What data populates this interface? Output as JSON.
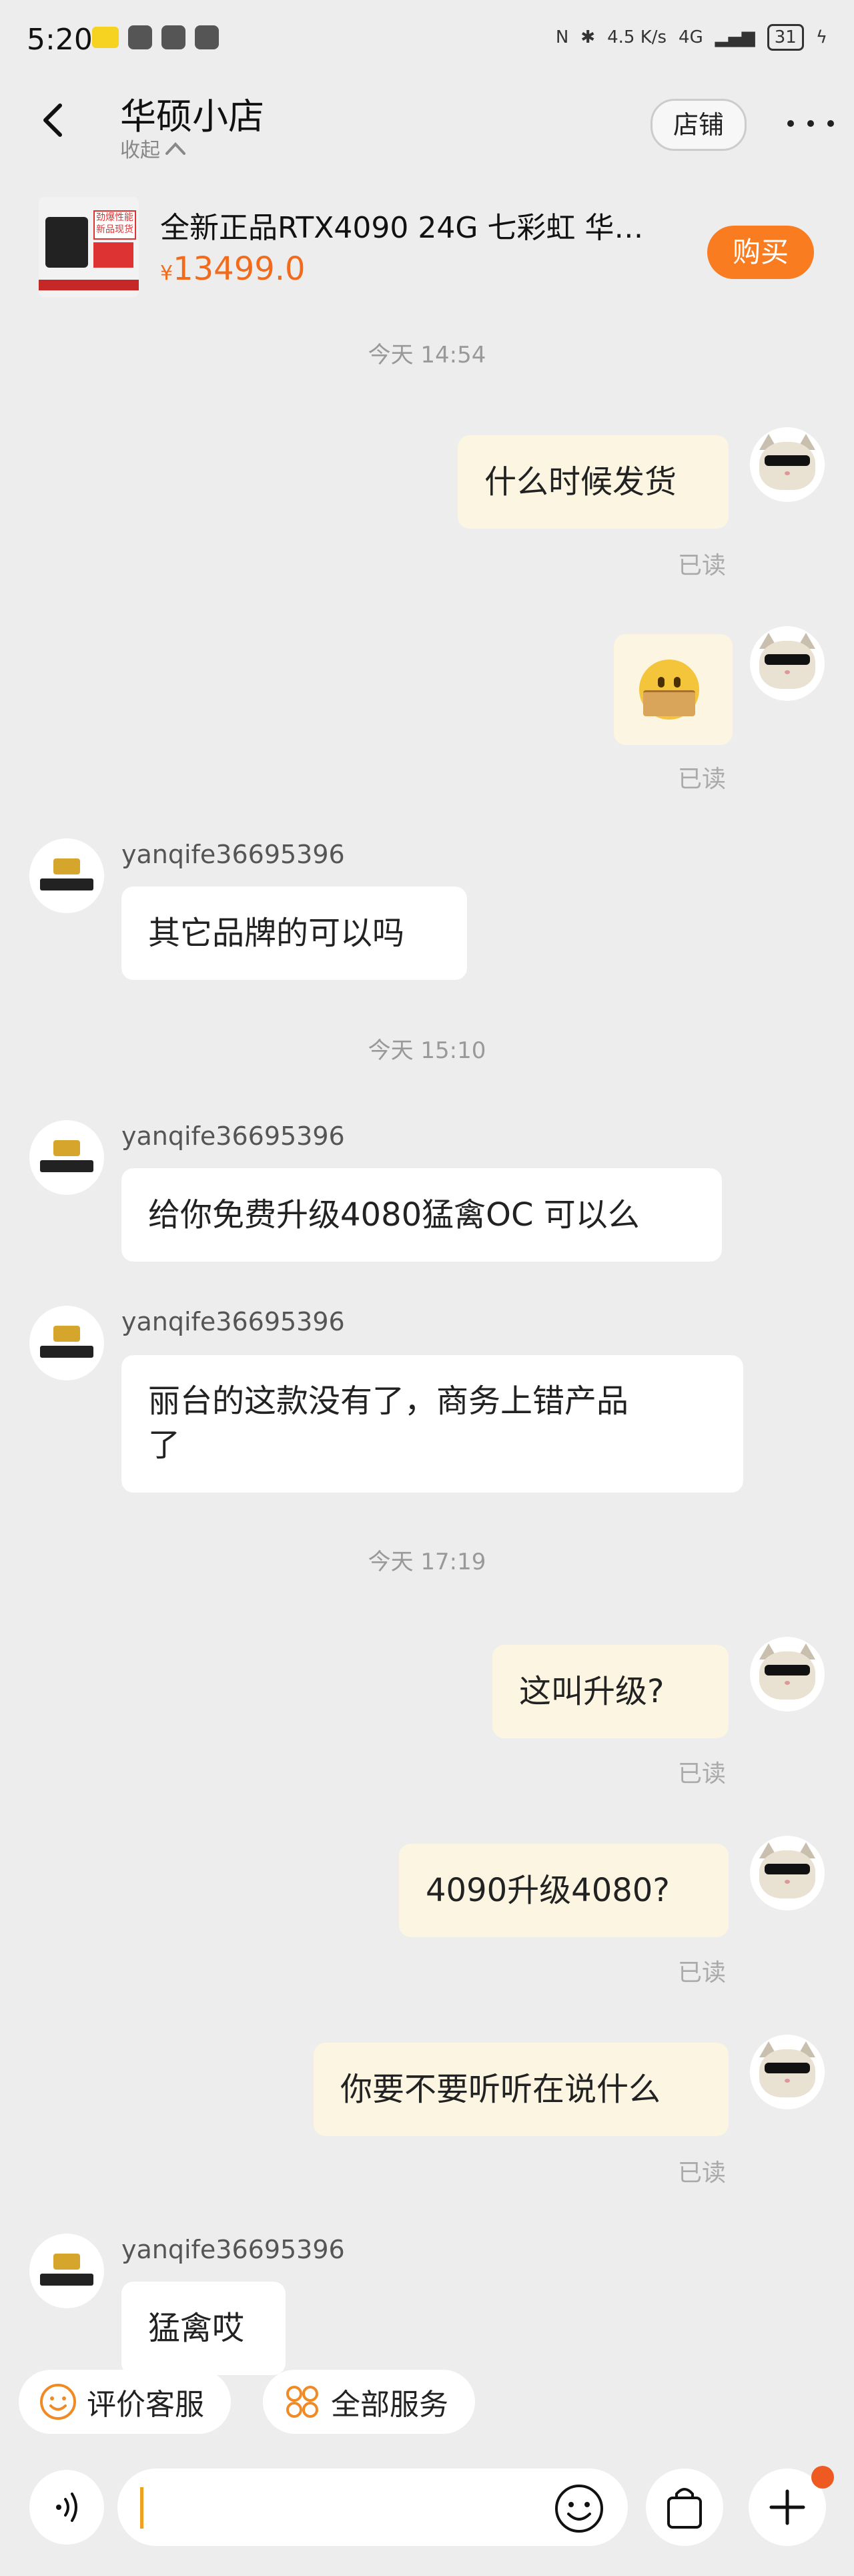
{
  "status_bar": {
    "time": "5:20",
    "net_speed": "4.5 K/s",
    "signal": "4G",
    "battery": "31"
  },
  "header": {
    "shop_name": "华硕小店",
    "collapse_label": "收起",
    "store_button": "店铺"
  },
  "product": {
    "thumb_label": "劲爆性能 新品现货",
    "name": "全新正品RTX4090 24G 七彩虹 华…",
    "price_symbol": "¥",
    "price": "13499.0",
    "buy_button": "购买"
  },
  "messages": {
    "time1": "今天 14:54",
    "m1": {
      "text": "什么时候发货",
      "read": "已读"
    },
    "m2": {
      "read": "已读"
    },
    "sender": "yanqife36695396",
    "m3": {
      "text": "其它品牌的可以吗"
    },
    "time2": "今天 15:10",
    "m4": {
      "text": "给你免费升级4080猛禽OC 可以么"
    },
    "m5": {
      "line1": "丽台的这款没有了，商务上错产品",
      "line2": "了"
    },
    "time3": "今天 17:19",
    "m6": {
      "text": "这叫升级?",
      "read": "已读"
    },
    "m7": {
      "text": "4090升级4080?",
      "read": "已读"
    },
    "m8": {
      "text": "你要不要听听在说什么",
      "read": "已读"
    },
    "m9": {
      "text": "猛禽哎"
    }
  },
  "quick_actions": {
    "rate": "评价客服",
    "services": "全部服务"
  },
  "colors": {
    "accent": "#f97c20",
    "price": "#f26b1d",
    "out_bubble": "#fbf5e2",
    "background": "#ededed"
  }
}
